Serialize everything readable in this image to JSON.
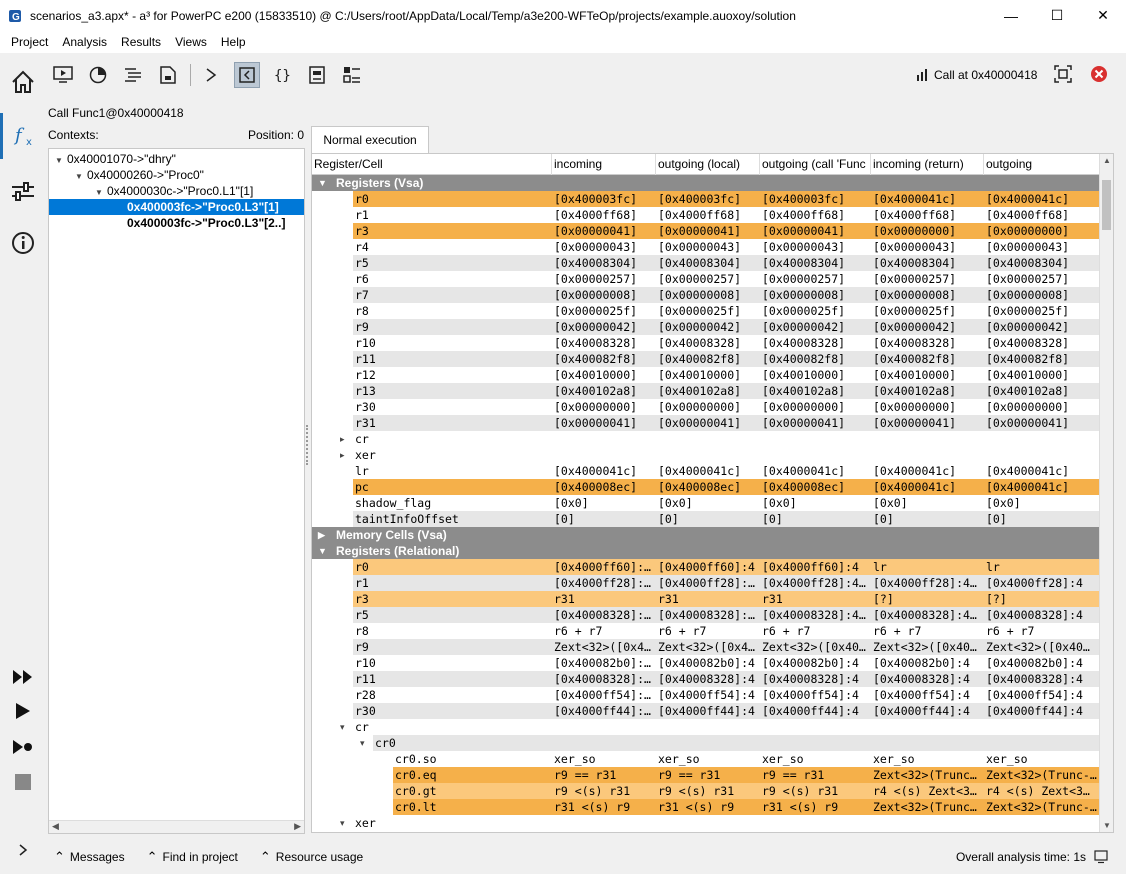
{
  "window": {
    "title": "scenarios_a3.apx* - a³ for PowerPC e200 (15833510) @ C:/Users/root/AppData/Local/Temp/a3e200-WFTeOp/projects/example.auoxoy/solution",
    "minimize": "—",
    "maximize": "☐",
    "close": "✕"
  },
  "menu": [
    "Project",
    "Analysis",
    "Results",
    "Views",
    "Help"
  ],
  "toolbar": {
    "call_label": "Call at 0x40000418"
  },
  "left": {
    "title": "Call Func1@0x40000418",
    "contexts_label": "Contexts:",
    "position_label": "Position: 0",
    "tree": [
      {
        "label": "0x40001070->\"dhry\"",
        "indent": 0,
        "arrow": "▼",
        "selected": false,
        "bold": false
      },
      {
        "label": "0x40000260->\"Proc0\"",
        "indent": 1,
        "arrow": "▼",
        "selected": false,
        "bold": false
      },
      {
        "label": "0x4000030c->\"Proc0.L1\"[1]",
        "indent": 2,
        "arrow": "▼",
        "selected": false,
        "bold": false
      },
      {
        "label": "0x400003fc->\"Proc0.L3\"[1]",
        "indent": 3,
        "arrow": "",
        "selected": true,
        "bold": true
      },
      {
        "label": "0x400003fc->\"Proc0.L3\"[2..]",
        "indent": 3,
        "arrow": "",
        "selected": false,
        "bold": true
      }
    ]
  },
  "tab": "Normal execution",
  "columns": [
    "Register/Cell",
    "incoming",
    "outgoing (local)",
    "outgoing (call 'Func",
    "incoming (return)",
    "outgoing"
  ],
  "rows": [
    {
      "t": "grp",
      "label": "Registers (Vsa)",
      "arrow": "▼"
    },
    {
      "t": "r",
      "s": "hl",
      "i": 1,
      "name": "r0",
      "v": [
        "[0x400003fc]",
        "[0x400003fc]",
        "[0x400003fc]",
        "[0x4000041c]",
        "[0x4000041c]"
      ]
    },
    {
      "t": "r",
      "s": "",
      "i": 1,
      "name": "r1",
      "v": [
        "[0x4000ff68]",
        "[0x4000ff68]",
        "[0x4000ff68]",
        "[0x4000ff68]",
        "[0x4000ff68]"
      ]
    },
    {
      "t": "r",
      "s": "hl",
      "i": 1,
      "name": "r3",
      "v": [
        "[0x00000041]",
        "[0x00000041]",
        "[0x00000041]",
        "[0x00000000]",
        "[0x00000000]"
      ]
    },
    {
      "t": "r",
      "s": "",
      "i": 1,
      "name": "r4",
      "v": [
        "[0x00000043]",
        "[0x00000043]",
        "[0x00000043]",
        "[0x00000043]",
        "[0x00000043]"
      ]
    },
    {
      "t": "r",
      "s": "alt",
      "i": 1,
      "name": "r5",
      "v": [
        "[0x40008304]",
        "[0x40008304]",
        "[0x40008304]",
        "[0x40008304]",
        "[0x40008304]"
      ]
    },
    {
      "t": "r",
      "s": "",
      "i": 1,
      "name": "r6",
      "v": [
        "[0x00000257]",
        "[0x00000257]",
        "[0x00000257]",
        "[0x00000257]",
        "[0x00000257]"
      ]
    },
    {
      "t": "r",
      "s": "alt",
      "i": 1,
      "name": "r7",
      "v": [
        "[0x00000008]",
        "[0x00000008]",
        "[0x00000008]",
        "[0x00000008]",
        "[0x00000008]"
      ]
    },
    {
      "t": "r",
      "s": "",
      "i": 1,
      "name": "r8",
      "v": [
        "[0x0000025f]",
        "[0x0000025f]",
        "[0x0000025f]",
        "[0x0000025f]",
        "[0x0000025f]"
      ]
    },
    {
      "t": "r",
      "s": "alt",
      "i": 1,
      "name": "r9",
      "v": [
        "[0x00000042]",
        "[0x00000042]",
        "[0x00000042]",
        "[0x00000042]",
        "[0x00000042]"
      ]
    },
    {
      "t": "r",
      "s": "",
      "i": 1,
      "name": "r10",
      "v": [
        "[0x40008328]",
        "[0x40008328]",
        "[0x40008328]",
        "[0x40008328]",
        "[0x40008328]"
      ]
    },
    {
      "t": "r",
      "s": "alt",
      "i": 1,
      "name": "r11",
      "v": [
        "[0x400082f8]",
        "[0x400082f8]",
        "[0x400082f8]",
        "[0x400082f8]",
        "[0x400082f8]"
      ]
    },
    {
      "t": "r",
      "s": "",
      "i": 1,
      "name": "r12",
      "v": [
        "[0x40010000]",
        "[0x40010000]",
        "[0x40010000]",
        "[0x40010000]",
        "[0x40010000]"
      ]
    },
    {
      "t": "r",
      "s": "alt",
      "i": 1,
      "name": "r13",
      "v": [
        "[0x400102a8]",
        "[0x400102a8]",
        "[0x400102a8]",
        "[0x400102a8]",
        "[0x400102a8]"
      ]
    },
    {
      "t": "r",
      "s": "",
      "i": 1,
      "name": "r30",
      "v": [
        "[0x00000000]",
        "[0x00000000]",
        "[0x00000000]",
        "[0x00000000]",
        "[0x00000000]"
      ]
    },
    {
      "t": "r",
      "s": "alt",
      "i": 1,
      "name": "r31",
      "v": [
        "[0x00000041]",
        "[0x00000041]",
        "[0x00000041]",
        "[0x00000041]",
        "[0x00000041]"
      ]
    },
    {
      "t": "r",
      "s": "",
      "i": 1,
      "name": "cr",
      "ex": "▸",
      "v": [
        "",
        "",
        "",
        "",
        ""
      ]
    },
    {
      "t": "r",
      "s": "",
      "i": 1,
      "name": "xer",
      "ex": "▸",
      "v": [
        "",
        "",
        "",
        "",
        ""
      ]
    },
    {
      "t": "r",
      "s": "",
      "i": 1,
      "name": "lr",
      "v": [
        "[0x4000041c]",
        "[0x4000041c]",
        "[0x4000041c]",
        "[0x4000041c]",
        "[0x4000041c]"
      ]
    },
    {
      "t": "r",
      "s": "hl",
      "i": 1,
      "name": "pc",
      "v": [
        "[0x400008ec]",
        "[0x400008ec]",
        "[0x400008ec]",
        "[0x4000041c]",
        "[0x4000041c]"
      ]
    },
    {
      "t": "r",
      "s": "",
      "i": 1,
      "name": "shadow_flag",
      "v": [
        "[0x0]",
        "[0x0]",
        "[0x0]",
        "[0x0]",
        "[0x0]"
      ]
    },
    {
      "t": "r",
      "s": "alt",
      "i": 1,
      "name": "taintInfoOffset",
      "v": [
        "[0]",
        "[0]",
        "[0]",
        "[0]",
        "[0]"
      ]
    },
    {
      "t": "grp",
      "label": "Memory Cells (Vsa)",
      "arrow": "▶"
    },
    {
      "t": "grp",
      "label": "Registers (Relational)",
      "arrow": "▼"
    },
    {
      "t": "r",
      "s": "hl2",
      "i": 1,
      "name": "r0",
      "v": [
        "[0x4000ff60]:…",
        "[0x4000ff60]:4",
        "[0x4000ff60]:4",
        "lr",
        "lr"
      ]
    },
    {
      "t": "r",
      "s": "alt",
      "i": 1,
      "name": "r1",
      "v": [
        "[0x4000ff28]:…",
        "[0x4000ff28]:…",
        "[0x4000ff28]:4…",
        "[0x4000ff28]:4…",
        "[0x4000ff28]:4"
      ]
    },
    {
      "t": "r",
      "s": "hl2",
      "i": 1,
      "name": "r3",
      "v": [
        "r31",
        "r31",
        "r31",
        "[?]",
        "[?]"
      ]
    },
    {
      "t": "r",
      "s": "alt",
      "i": 1,
      "name": "r5",
      "v": [
        "[0x40008328]:…",
        "[0x40008328]:…",
        "[0x40008328]:4…",
        "[0x40008328]:4…",
        "[0x40008328]:4"
      ]
    },
    {
      "t": "r",
      "s": "",
      "i": 1,
      "name": "r8",
      "v": [
        "r6 + r7",
        "r6 + r7",
        "r6 + r7",
        "r6 + r7",
        "r6 + r7"
      ]
    },
    {
      "t": "r",
      "s": "alt",
      "i": 1,
      "name": "r9",
      "v": [
        "Zext<32>([0x4…",
        "Zext<32>([0x4…",
        "Zext<32>([0x40…",
        "Zext<32>([0x40…",
        "Zext<32>([0x40…"
      ]
    },
    {
      "t": "r",
      "s": "",
      "i": 1,
      "name": "r10",
      "v": [
        "[0x400082b0]:…",
        "[0x400082b0]:4",
        "[0x400082b0]:4",
        "[0x400082b0]:4",
        "[0x400082b0]:4"
      ]
    },
    {
      "t": "r",
      "s": "alt",
      "i": 1,
      "name": "r11",
      "v": [
        "[0x40008328]:…",
        "[0x40008328]:4",
        "[0x40008328]:4",
        "[0x40008328]:4",
        "[0x40008328]:4"
      ]
    },
    {
      "t": "r",
      "s": "",
      "i": 1,
      "name": "r28",
      "v": [
        "[0x4000ff54]:…",
        "[0x4000ff54]:4",
        "[0x4000ff54]:4",
        "[0x4000ff54]:4",
        "[0x4000ff54]:4"
      ]
    },
    {
      "t": "r",
      "s": "alt",
      "i": 1,
      "name": "r30",
      "v": [
        "[0x4000ff44]:…",
        "[0x4000ff44]:4",
        "[0x4000ff44]:4",
        "[0x4000ff44]:4",
        "[0x4000ff44]:4"
      ]
    },
    {
      "t": "r",
      "s": "",
      "i": 1,
      "name": "cr",
      "ex": "▾",
      "v": [
        "",
        "",
        "",
        "",
        ""
      ]
    },
    {
      "t": "r",
      "s": "alt",
      "i": 2,
      "name": "cr0",
      "ex": "▾",
      "v": [
        "",
        "",
        "",
        "",
        ""
      ]
    },
    {
      "t": "r",
      "s": "",
      "i": 3,
      "name": "cr0.so",
      "v": [
        "xer_so",
        "xer_so",
        "xer_so",
        "xer_so",
        "xer_so"
      ]
    },
    {
      "t": "r",
      "s": "hl",
      "i": 3,
      "name": "cr0.eq",
      "v": [
        "r9 == r31",
        "r9 == r31",
        "r9 == r31",
        "Zext<32>(Trunc…",
        "Zext<32>(Trunc-…"
      ]
    },
    {
      "t": "r",
      "s": "hl2",
      "i": 3,
      "name": "cr0.gt",
      "v": [
        "r9 <(s) r31",
        "r9 <(s) r31",
        "r9 <(s) r31",
        "r4 <(s) Zext<3…",
        "r4 <(s) Zext<3…"
      ]
    },
    {
      "t": "r",
      "s": "hl",
      "i": 3,
      "name": "cr0.lt",
      "v": [
        "r31 <(s) r9",
        "r31 <(s) r9",
        "r31 <(s) r9",
        "Zext<32>(Trunc…",
        "Zext<32>(Trunc-…"
      ]
    },
    {
      "t": "r",
      "s": "",
      "i": 1,
      "name": "xer",
      "ex": "▾",
      "v": [
        "",
        "",
        "",
        "",
        ""
      ]
    }
  ],
  "status": {
    "messages": "Messages",
    "find": "Find in project",
    "resource": "Resource usage",
    "time": "Overall analysis time: 1s"
  }
}
